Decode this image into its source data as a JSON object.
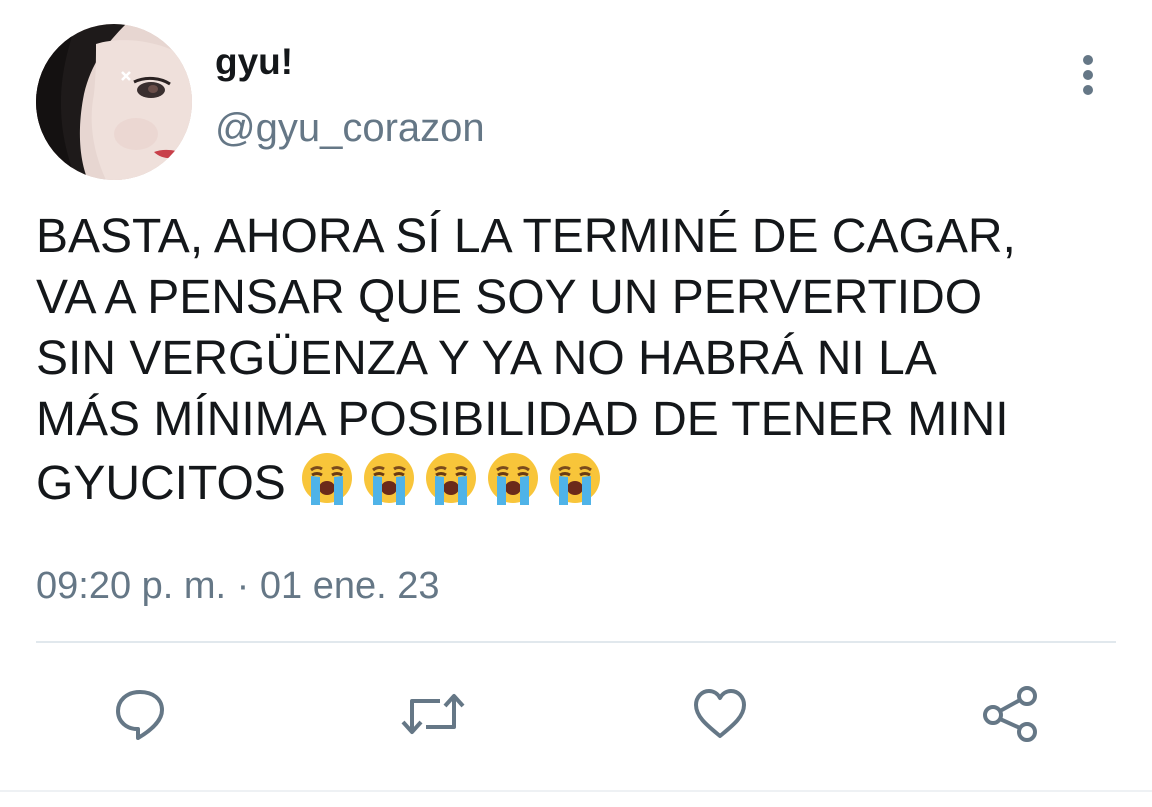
{
  "tweet": {
    "author": {
      "display_name": "gyu!",
      "handle": "@gyu_corazon"
    },
    "text_lines": [
      "BASTA, AHORA SÍ LA TERMINÉ DE CAGAR,",
      "VA A PENSAR QUE SOY UN PERVERTIDO",
      "SIN VERGÜENZA Y YA NO HABRÁ NI LA",
      "MÁS MÍNIMA POSIBILIDAD DE TENER MINI",
      "GYUCITOS"
    ],
    "emojis": [
      "loudly-crying-face",
      "loudly-crying-face",
      "loudly-crying-face",
      "loudly-crying-face",
      "loudly-crying-face"
    ],
    "timestamp": "09:20 p. m. · 01 ene. 23",
    "actions": [
      "reply-icon",
      "retweet-icon",
      "like-icon",
      "share-icon"
    ]
  },
  "colors": {
    "text": "#14171a",
    "secondary": "#657786",
    "divider": "#e1e8ed"
  }
}
